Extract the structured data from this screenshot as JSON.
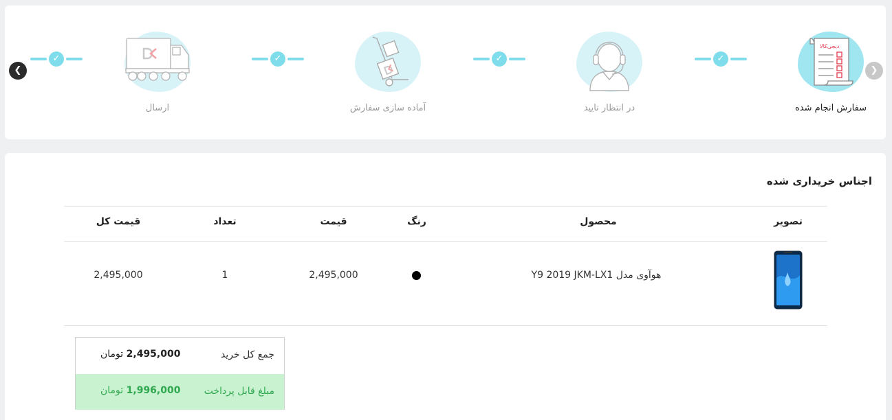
{
  "steps": [
    {
      "label": "ارسال",
      "icon": "truck-icon",
      "active": false
    },
    {
      "label": "آماده سازی سفارش",
      "icon": "hand-truck-icon",
      "active": false
    },
    {
      "label": "در انتظار تایید",
      "icon": "support-agent-icon",
      "active": false
    },
    {
      "label": "سفارش انجام شده",
      "icon": "invoice-checklist-icon",
      "active": true
    }
  ],
  "invoice_brand": "دیجی‌کالا",
  "nav": {
    "prev_icon": "chevron-left-icon",
    "next_icon": "chevron-right-icon"
  },
  "items_section": {
    "title": "اجناس خریداری شده",
    "headers": {
      "image": "تصویر",
      "product": "محصول",
      "color": "رنگ",
      "price": "قیمت",
      "qty": "تعداد",
      "total": "قیمت کل"
    },
    "rows": [
      {
        "product": "هوآوی مدل Y9 2019 JKM-LX1",
        "color": "#000000",
        "price": "2,495,000",
        "qty": "1",
        "total": "2,495,000",
        "image_icon": "phone-image"
      }
    ]
  },
  "summary": {
    "total_label": "جمع کل خرید",
    "total_value": "2,495,000",
    "total_currency": "تومان",
    "payable_label": "مبلغ قابل پرداخت",
    "payable_value": "1,996,000",
    "payable_currency": "تومان"
  },
  "colors": {
    "accent": "#7fdcea",
    "blob": "#d8f3f8",
    "blob_active": "#9fe6f0",
    "success_bg": "#c9f2d0",
    "success_text": "#2fa84f"
  }
}
